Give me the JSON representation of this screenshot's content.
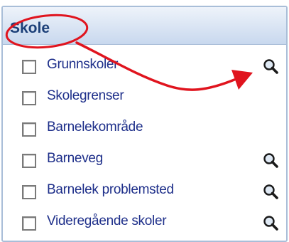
{
  "panel": {
    "title": "Skole",
    "items": [
      {
        "label": "Grunnskoler",
        "checked": false,
        "zoom": true
      },
      {
        "label": "Skolegrenser",
        "checked": false,
        "zoom": false
      },
      {
        "label": "Barnelekområde",
        "checked": false,
        "zoom": false
      },
      {
        "label": "Barneveg",
        "checked": false,
        "zoom": true
      },
      {
        "label": "Barnelek problemsted",
        "checked": false,
        "zoom": true
      },
      {
        "label": "Videregående skoler",
        "checked": false,
        "zoom": true
      }
    ]
  },
  "icons": {
    "zoom": "magnifier-icon",
    "checkbox": "checkbox"
  },
  "colors": {
    "header_text": "#1c3f78",
    "item_text": "#1e2f8a",
    "annotation": "#e0141e",
    "border": "#a9bed8"
  }
}
